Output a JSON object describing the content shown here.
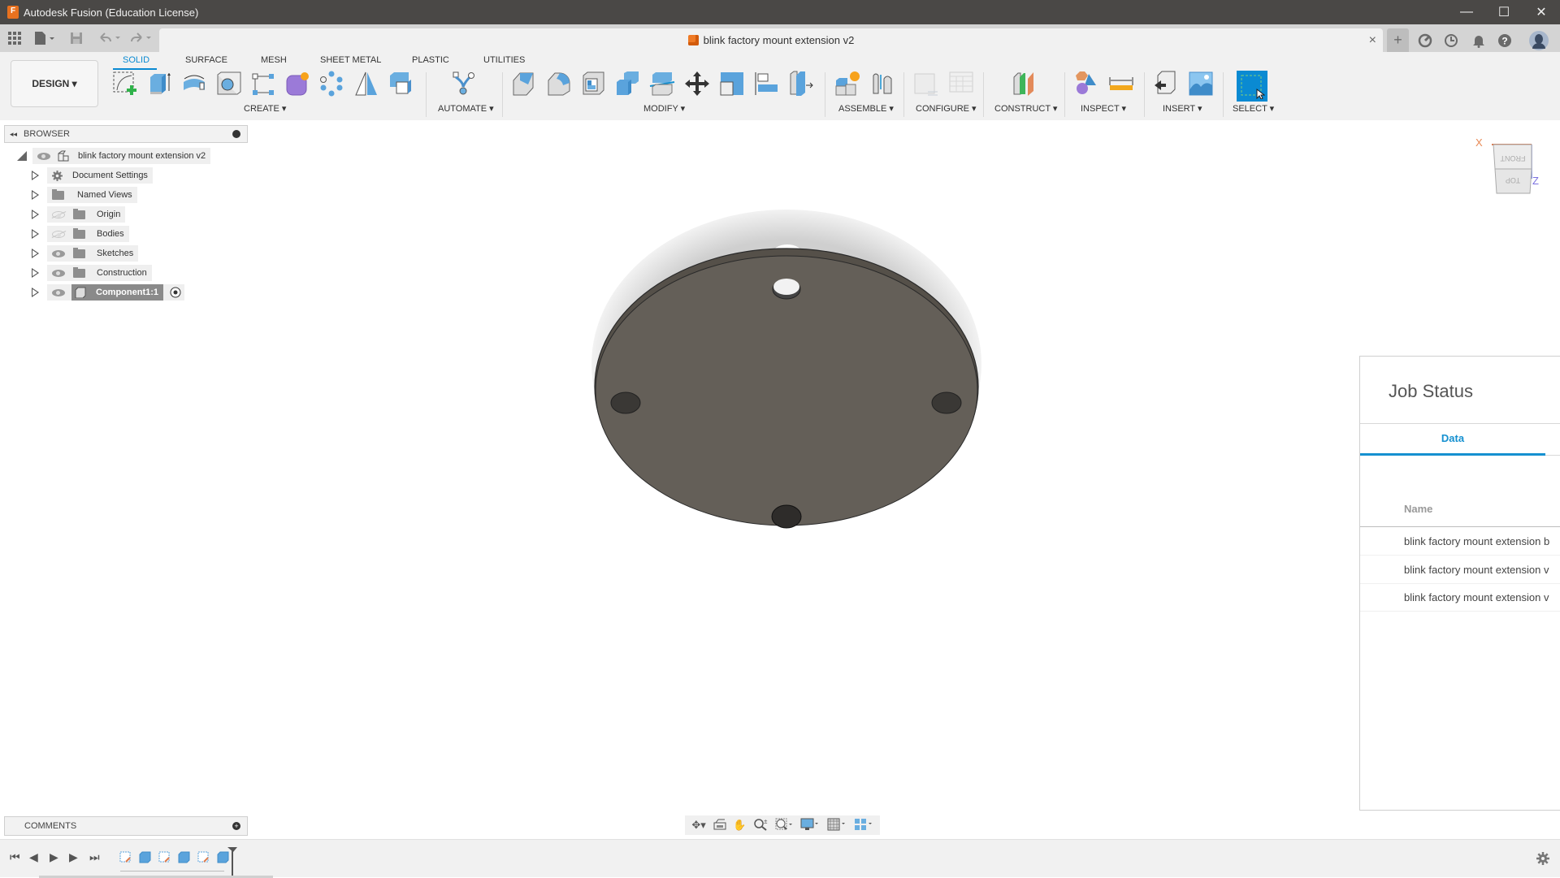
{
  "window": {
    "title": "Autodesk Fusion (Education License)",
    "controls": [
      "minimize-icon",
      "maximize-icon",
      "close-icon"
    ]
  },
  "quick_access": {
    "icons": [
      "app-grid-icon",
      "file-icon",
      "save-icon",
      "undo-icon",
      "redo-icon"
    ]
  },
  "document_tab": {
    "title": "blink factory mount extension v2",
    "close": "×"
  },
  "right_tools": [
    "new-tab-icon",
    "extensions-icon",
    "job-status-icon",
    "notifications-icon",
    "help-icon",
    "user-avatar"
  ],
  "workspace": {
    "label": "DESIGN ▾"
  },
  "ribbon": {
    "tabs": [
      {
        "label": "SOLID",
        "active": true
      },
      {
        "label": "SURFACE",
        "active": false
      },
      {
        "label": "MESH",
        "active": false
      },
      {
        "label": "SHEET METAL",
        "active": false
      },
      {
        "label": "PLASTIC",
        "active": false
      },
      {
        "label": "UTILITIES",
        "active": false
      }
    ],
    "groups": [
      {
        "label": "CREATE ▾",
        "tools": [
          "create-sketch",
          "extrude",
          "revolve",
          "hole",
          "derive-pattern",
          "form",
          "pattern",
          "mirror",
          "combine"
        ]
      },
      {
        "label": "AUTOMATE ▾",
        "tools": [
          "automate"
        ]
      },
      {
        "label": "MODIFY ▾",
        "tools": [
          "chamfer",
          "fillet",
          "shell",
          "combine-bodies",
          "offset-face",
          "move-copy",
          "scale",
          "align",
          "press-pull"
        ]
      },
      {
        "label": "ASSEMBLE ▾",
        "tools": [
          "new-component",
          "joint"
        ]
      },
      {
        "label": "CONFIGURE ▾",
        "tools": [
          "configure",
          "configure-table"
        ]
      },
      {
        "label": "CONSTRUCT ▾",
        "tools": [
          "offset-plane"
        ]
      },
      {
        "label": "INSPECT ▾",
        "tools": [
          "interference",
          "measure"
        ]
      },
      {
        "label": "INSERT ▾",
        "tools": [
          "insert-derive",
          "canvas"
        ]
      },
      {
        "label": "SELECT ▾",
        "tools": [
          "select"
        ]
      }
    ]
  },
  "browser": {
    "title": "BROWSER",
    "root": "blink factory mount extension v2",
    "items": [
      {
        "label": "Document Settings",
        "icon": "gear",
        "visible": null
      },
      {
        "label": "Named Views",
        "icon": "folder",
        "visible": null
      },
      {
        "label": "Origin",
        "icon": "folder",
        "visible": false
      },
      {
        "label": "Bodies",
        "icon": "folder",
        "visible": false
      },
      {
        "label": "Sketches",
        "icon": "folder",
        "visible": true
      },
      {
        "label": "Construction",
        "icon": "folder",
        "visible": true
      },
      {
        "label": "Component1:1",
        "icon": "component",
        "visible": true,
        "active": true
      }
    ]
  },
  "viewcube": {
    "x_label": "X",
    "z_label": "Z",
    "front": "FRONT",
    "top": "TOP"
  },
  "job_status": {
    "title": "Job Status",
    "tab": "Data",
    "column": "Name",
    "rows": [
      "blink factory mount extension b",
      "blink factory mount extension v",
      "blink factory mount extension v"
    ]
  },
  "comments": {
    "title": "COMMENTS"
  },
  "navbar": [
    "orbit-icon",
    "look-at-icon",
    "pan-icon",
    "zoom-icon",
    "fit-icon",
    "display-settings-icon",
    "grid-icon",
    "viewports-icon"
  ],
  "timeline": {
    "controls": [
      "first-icon",
      "previous-icon",
      "play-icon",
      "next-icon",
      "last-icon"
    ],
    "features": [
      "sketch",
      "extrude",
      "sketch",
      "extrude",
      "sketch",
      "extrude"
    ]
  },
  "colors": {
    "accent": "#0a8ad2",
    "body": "#645f58",
    "titlebar": "#4a4846"
  }
}
